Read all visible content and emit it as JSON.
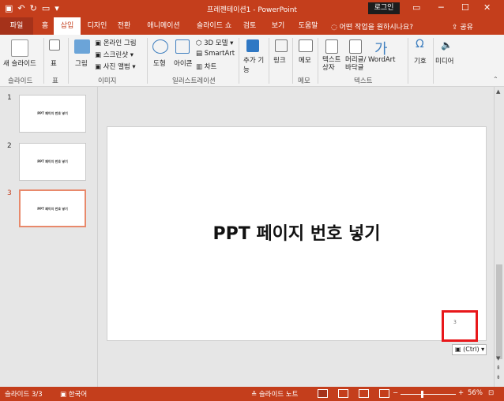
{
  "titlebar": {
    "doc_title": "프레젠테이션1 - PowerPoint",
    "login_label": "로그인",
    "qat_icons": [
      "save-icon",
      "undo-icon",
      "redo-icon",
      "present-icon",
      "customize-icon"
    ]
  },
  "tabs": {
    "file": "파일",
    "items": [
      "홈",
      "삽입",
      "디자인",
      "전환",
      "애니메이션",
      "슬라이드 쇼",
      "검토",
      "보기",
      "도움말"
    ],
    "active": "삽입",
    "search_placeholder": "어떤 작업을 원하시나요?",
    "share": "공유"
  },
  "ribbon": {
    "groups": [
      {
        "label": "슬라이드",
        "items": [
          "새 슬라이드"
        ]
      },
      {
        "label": "표",
        "items": [
          "표"
        ]
      },
      {
        "label": "이미지",
        "items": [
          "그림",
          "온라인 그림",
          "스크린샷",
          "사진 앨범"
        ]
      },
      {
        "label": "일러스트레이션",
        "items": [
          "도형",
          "아이콘",
          "3D 모델",
          "SmartArt",
          "차트"
        ]
      },
      {
        "label": "",
        "items": [
          "추가 기능"
        ]
      },
      {
        "label": "",
        "items": [
          "링크"
        ]
      },
      {
        "label": "메모",
        "items": [
          "메모"
        ]
      },
      {
        "label": "텍스트",
        "items": [
          "텍스트 상자",
          "머리글/바닥글",
          "WordArt"
        ]
      },
      {
        "label": "",
        "items": [
          "기호"
        ]
      },
      {
        "label": "",
        "items": [
          "미디어"
        ]
      }
    ]
  },
  "slides": [
    {
      "number": "1",
      "text": "PPT 페이지 번호 넣기"
    },
    {
      "number": "2",
      "text": "PPT 페이지 번호 넣기"
    },
    {
      "number": "3",
      "text": "PPT 페이지 번호 넣기"
    }
  ],
  "main_slide": {
    "title": "PPT 페이지 번호 넣기",
    "slide_number": "3"
  },
  "paste_options": "(Ctrl)",
  "statusbar": {
    "slide_info": "슬라이드 3/3",
    "language": "한국어",
    "notes": "슬라이드 노트",
    "zoom": "56%"
  }
}
